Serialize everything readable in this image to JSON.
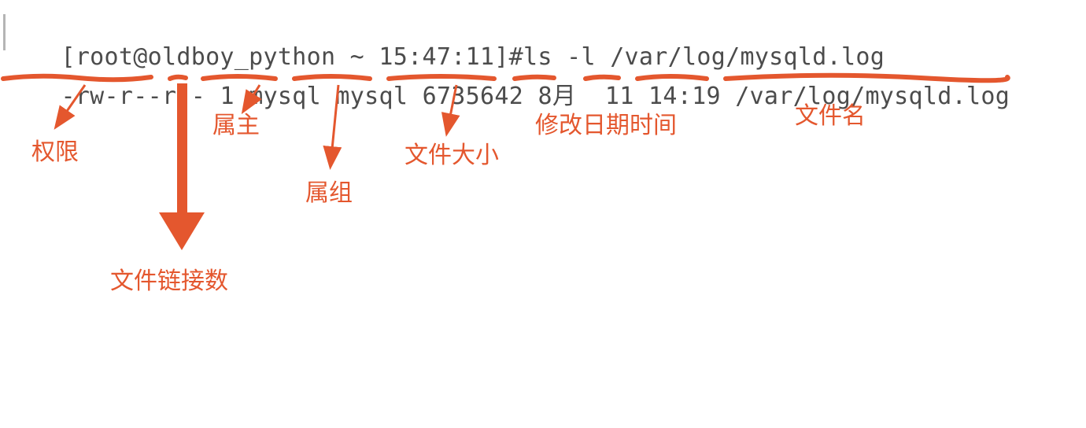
{
  "terminal": {
    "line1_prompt": "[root@oldboy_python ~ 15:47:11]#",
    "line1_cmd": "ls -l /var/log/mysqld.log",
    "line2_perms": "-rw-r--r--",
    "line2_links": "1",
    "line2_owner": "mysql",
    "line2_group": "mysql",
    "line2_size": "6735642",
    "line2_month": "8月",
    "line2_day": "11",
    "line2_time": "14:19",
    "line2_name": "/var/log/mysqld.log"
  },
  "labels": {
    "perms": "权限",
    "links": "文件链接数",
    "owner": "属主",
    "group": "属组",
    "size": "文件大小",
    "mtime": "修改日期时间",
    "filename": "文件名"
  },
  "colors": {
    "annotation": "#e4572e",
    "text": "#4c4c4c"
  }
}
